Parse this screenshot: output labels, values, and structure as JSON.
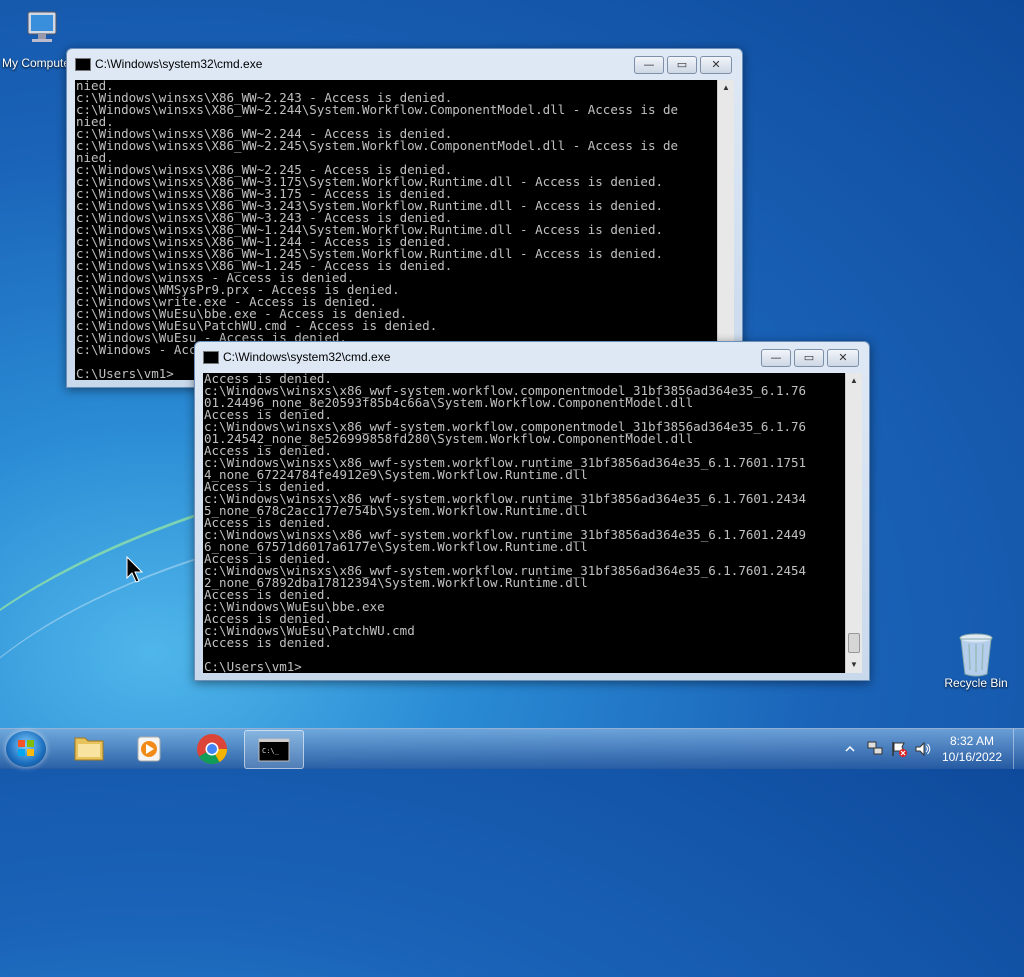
{
  "desktop": {
    "icons": [
      {
        "label": "My Computer"
      },
      {
        "label": "Recycle Bin"
      }
    ]
  },
  "window_back": {
    "title": "C:\\Windows\\system32\\cmd.exe",
    "lines": [
      "nied.",
      "c:\\Windows\\winsxs\\X86_WW~2.243 - Access is denied.",
      "c:\\Windows\\winsxs\\X86_WW~2.244\\System.Workflow.ComponentModel.dll - Access is de",
      "nied.",
      "c:\\Windows\\winsxs\\X86_WW~2.244 - Access is denied.",
      "c:\\Windows\\winsxs\\X86_WW~2.245\\System.Workflow.ComponentModel.dll - Access is de",
      "nied.",
      "c:\\Windows\\winsxs\\X86_WW~2.245 - Access is denied.",
      "c:\\Windows\\winsxs\\X86_WW~3.175\\System.Workflow.Runtime.dll - Access is denied.",
      "c:\\Windows\\winsxs\\X86_WW~3.175 - Access is denied.",
      "c:\\Windows\\winsxs\\X86_WW~3.243\\System.Workflow.Runtime.dll - Access is denied.",
      "c:\\Windows\\winsxs\\X86_WW~3.243 - Access is denied.",
      "c:\\Windows\\winsxs\\X86_WW~1.244\\System.Workflow.Runtime.dll - Access is denied.",
      "c:\\Windows\\winsxs\\X86_WW~1.244 - Access is denied.",
      "c:\\Windows\\winsxs\\X86_WW~1.245\\System.Workflow.Runtime.dll - Access is denied.",
      "c:\\Windows\\winsxs\\X86_WW~1.245 - Access is denied.",
      "c:\\Windows\\winsxs - Access is denied.",
      "c:\\Windows\\WMSysPr9.prx - Access is denied.",
      "c:\\Windows\\write.exe - Access is denied.",
      "c:\\Windows\\WuEsu\\bbe.exe - Access is denied.",
      "c:\\Windows\\WuEsu\\PatchWU.cmd - Access is denied.",
      "c:\\Windows\\WuEsu - Access is denied.",
      "c:\\Windows - Access is denied.",
      "",
      "C:\\Users\\vm1>"
    ]
  },
  "window_front": {
    "title": "C:\\Windows\\system32\\cmd.exe",
    "lines": [
      "Access is denied.",
      "c:\\Windows\\winsxs\\x86_wwf-system.workflow.componentmodel_31bf3856ad364e35_6.1.76",
      "01.24496_none_8e20593f85b4c66a\\System.Workflow.ComponentModel.dll",
      "Access is denied.",
      "c:\\Windows\\winsxs\\x86_wwf-system.workflow.componentmodel_31bf3856ad364e35_6.1.76",
      "01.24542_none_8e526999858fd280\\System.Workflow.ComponentModel.dll",
      "Access is denied.",
      "c:\\Windows\\winsxs\\x86_wwf-system.workflow.runtime_31bf3856ad364e35_6.1.7601.1751",
      "4_none_67224784fe4912e9\\System.Workflow.Runtime.dll",
      "Access is denied.",
      "c:\\Windows\\winsxs\\x86_wwf-system.workflow.runtime_31bf3856ad364e35_6.1.7601.2434",
      "5_none_678c2acc177e754b\\System.Workflow.Runtime.dll",
      "Access is denied.",
      "c:\\Windows\\winsxs\\x86_wwf-system.workflow.runtime_31bf3856ad364e35_6.1.7601.2449",
      "6_none_67571d6017a6177e\\System.Workflow.Runtime.dll",
      "Access is denied.",
      "c:\\Windows\\winsxs\\x86_wwf-system.workflow.runtime_31bf3856ad364e35_6.1.7601.2454",
      "2_none_67892dba17812394\\System.Workflow.Runtime.dll",
      "Access is denied.",
      "c:\\Windows\\WuEsu\\bbe.exe",
      "Access is denied.",
      "c:\\Windows\\WuEsu\\PatchWU.cmd",
      "Access is denied.",
      "",
      "C:\\Users\\vm1>"
    ]
  },
  "window_controls": {
    "minimize": "—",
    "maximize": "▭",
    "close": "✕"
  },
  "taskbar": {
    "items": [
      {
        "icon": "windows-explorer-icon"
      },
      {
        "icon": "media-player-icon"
      },
      {
        "icon": "chrome-icon"
      },
      {
        "icon": "cmd-icon"
      }
    ],
    "clock_time": "8:32 AM",
    "clock_date": "10/16/2022"
  },
  "colors": {
    "console_bg": "#000000",
    "console_text": "#c0c0c0"
  }
}
